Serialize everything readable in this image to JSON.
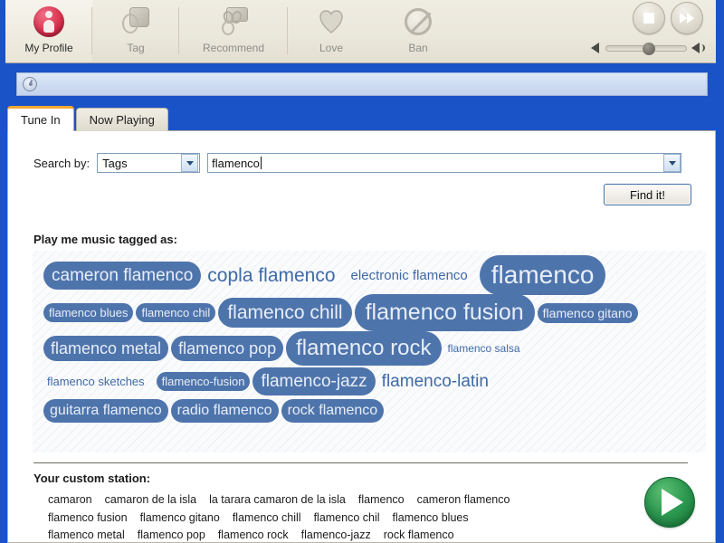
{
  "window": {
    "frame_color": "#1a52c8"
  },
  "toolbar": {
    "items": [
      {
        "label": "My Profile",
        "icon": "profile-icon",
        "selected": true
      },
      {
        "label": "Tag",
        "icon": "tag-icon",
        "selected": false
      },
      {
        "label": "Recommend",
        "icon": "recommend-icon",
        "selected": false
      },
      {
        "label": "Love",
        "icon": "heart-icon",
        "selected": false
      },
      {
        "label": "Ban",
        "icon": "ban-icon",
        "selected": false
      }
    ],
    "transport": {
      "stop_label": "Stop",
      "skip_label": "Skip",
      "volume_percent": 46
    }
  },
  "statusbar": {
    "icon": "disc-icon",
    "text": ""
  },
  "tabs": [
    {
      "label": "Tune In",
      "active": true
    },
    {
      "label": "Now Playing",
      "active": false
    }
  ],
  "search": {
    "label": "Search by:",
    "mode_value": "Tags",
    "query_value": "flamenco",
    "find_label": "Find it!"
  },
  "cloud": {
    "heading": "Play me music tagged as:",
    "rows": [
      [
        {
          "text": "cameron flamenco",
          "size": 19,
          "pill": true
        },
        {
          "text": "copla flamenco",
          "size": 21,
          "pill": false
        },
        {
          "text": "electronic flamenco",
          "size": 15,
          "pill": false
        },
        {
          "text": "flamenco",
          "size": 28,
          "pill": true
        }
      ],
      [
        {
          "text": "flamenco blues",
          "size": 13,
          "pill": true
        },
        {
          "text": "flamenco chil",
          "size": 13,
          "pill": true
        },
        {
          "text": "flamenco chill",
          "size": 21,
          "pill": true
        },
        {
          "text": "flamenco fusion",
          "size": 25,
          "pill": true
        },
        {
          "text": "flamenco gitano",
          "size": 14,
          "pill": true
        }
      ],
      [
        {
          "text": "flamenco metal",
          "size": 18,
          "pill": true
        },
        {
          "text": "flamenco pop",
          "size": 18,
          "pill": true
        },
        {
          "text": "flamenco rock",
          "size": 24,
          "pill": true
        },
        {
          "text": "flamenco salsa",
          "size": 12,
          "pill": false
        }
      ],
      [
        {
          "text": "flamenco sketches",
          "size": 13,
          "pill": false
        },
        {
          "text": "flamenco-fusion",
          "size": 13,
          "pill": true
        },
        {
          "text": "flamenco-jazz",
          "size": 19,
          "pill": true
        },
        {
          "text": "flamenco-latin",
          "size": 19,
          "pill": false
        }
      ],
      [
        {
          "text": "guitarra flamenco",
          "size": 16,
          "pill": true
        },
        {
          "text": "radio flamenco",
          "size": 16,
          "pill": true
        },
        {
          "text": "rock flamenco",
          "size": 16,
          "pill": true
        }
      ]
    ]
  },
  "station": {
    "heading": "Your custom station:",
    "lines": [
      [
        "camaron",
        "camaron de la isla",
        "la tarara camaron de la isla",
        "flamenco",
        "cameron flamenco"
      ],
      [
        "flamenco fusion",
        "flamenco gitano",
        "flamenco chill",
        "flamenco chil",
        "flamenco blues"
      ],
      [
        "flamenco metal",
        "flamenco pop",
        "flamenco rock",
        "flamenco-jazz",
        "rock flamenco"
      ]
    ],
    "play_label": "Play"
  },
  "colors": {
    "accent_blue": "#4e74ac",
    "tag_text": "#3f6aa8",
    "tab_active_top": "#f0a830",
    "play_green": "#2f9b52",
    "frame": "#1a52c8"
  }
}
